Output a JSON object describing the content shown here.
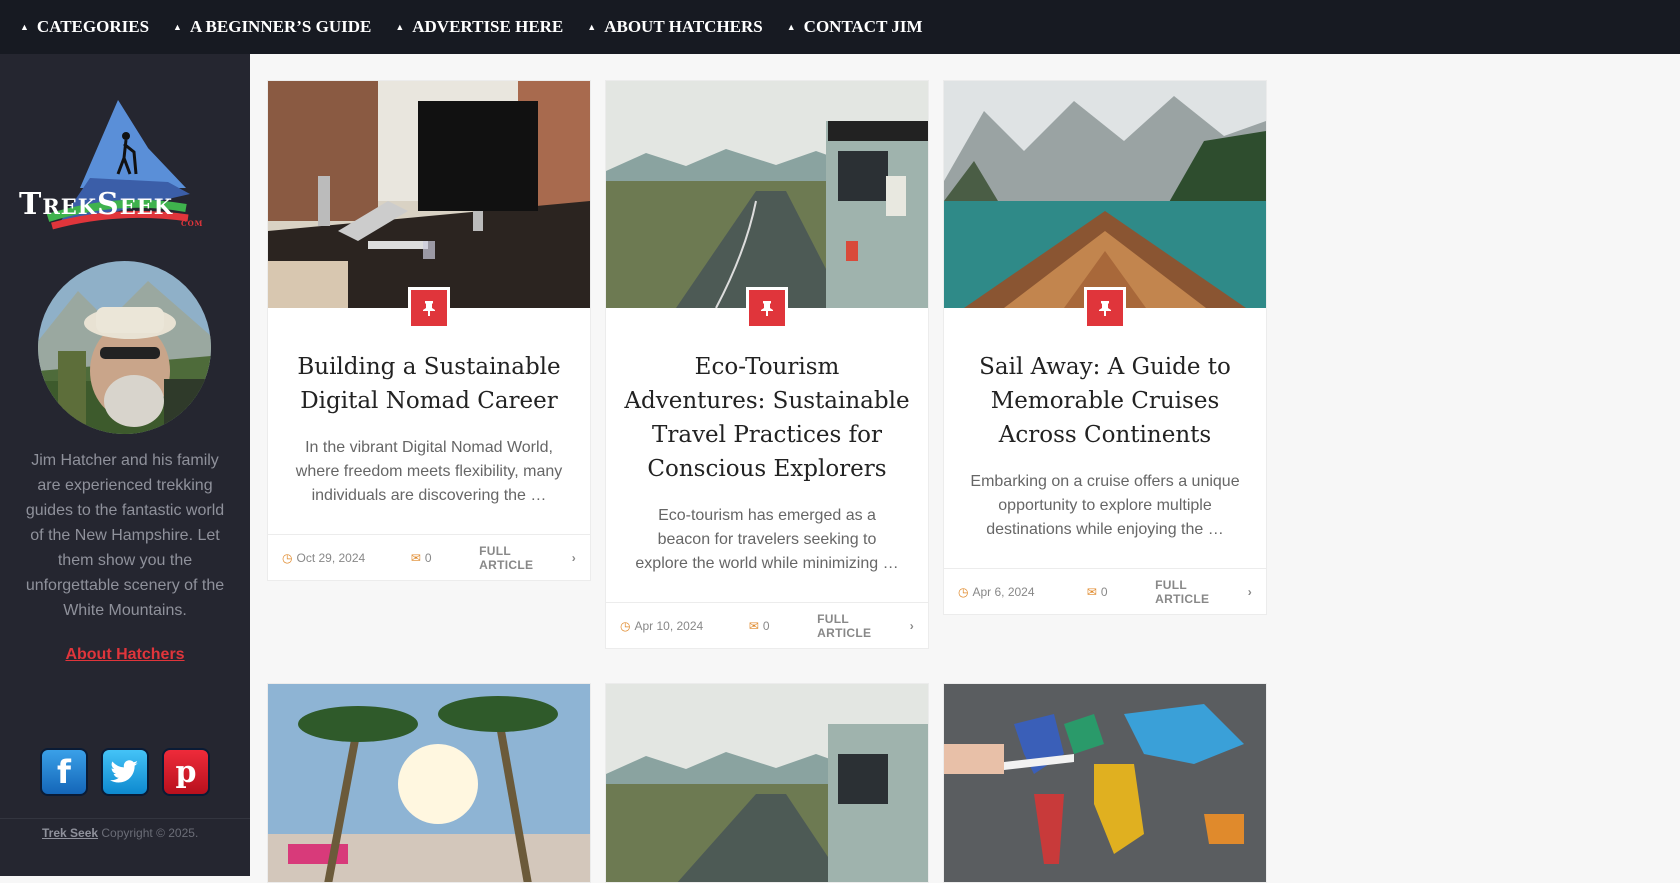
{
  "nav": {
    "items": [
      {
        "label": "CATEGORIES"
      },
      {
        "label": "A BEGINNER’S GUIDE"
      },
      {
        "label": "ADVERTISE HERE"
      },
      {
        "label": "ABOUT HATCHERS"
      },
      {
        "label": "CONTACT JIM"
      }
    ]
  },
  "sidebar": {
    "logo_text": "TrekSeek",
    "logo_sub": "com",
    "bio": "Jim Hatcher and his family are experienced trekking guides to the fantastic world of the New Hampshire. Let them show you the unforgettable scenery of the White Mountains.",
    "about_link": "About Hatchers",
    "socials": [
      {
        "icon": "facebook-icon",
        "letter": "f"
      },
      {
        "icon": "twitter-icon",
        "letter": "t"
      },
      {
        "icon": "pinterest-icon",
        "letter": "p"
      }
    ],
    "copyright_site": "Trek Seek",
    "copyright_text": " Copyright © 2025."
  },
  "posts": [
    {
      "title": "Building a Sustainable Digital Nomad Career",
      "excerpt": "In the vibrant Digital Nomad World, where freedom meets flexibility, many individuals are discovering the …",
      "date": "Oct 29, 2024",
      "comments": "0",
      "more": "FULL ARTICLE"
    },
    {
      "title": "Eco-Tourism Adventures: Sustainable Travel Practices for Conscious Explorers",
      "excerpt": "Eco-tourism has emerged as a beacon for travelers seeking to explore the world while minimizing …",
      "date": "Apr 10, 2024",
      "comments": "0",
      "more": "FULL ARTICLE"
    },
    {
      "title": "Sail Away: A Guide to Memorable Cruises Across Continents",
      "excerpt": "Embarking on a cruise offers a unique opportunity to explore multiple destinations while enjoying the …",
      "date": "Apr 6, 2024",
      "comments": "0",
      "more": "FULL ARTICLE"
    }
  ],
  "colors": {
    "accent": "#e0353b",
    "nav_bg": "#171a22",
    "sidebar_bg": "#252630",
    "meta_icon": "#e08a2c"
  }
}
